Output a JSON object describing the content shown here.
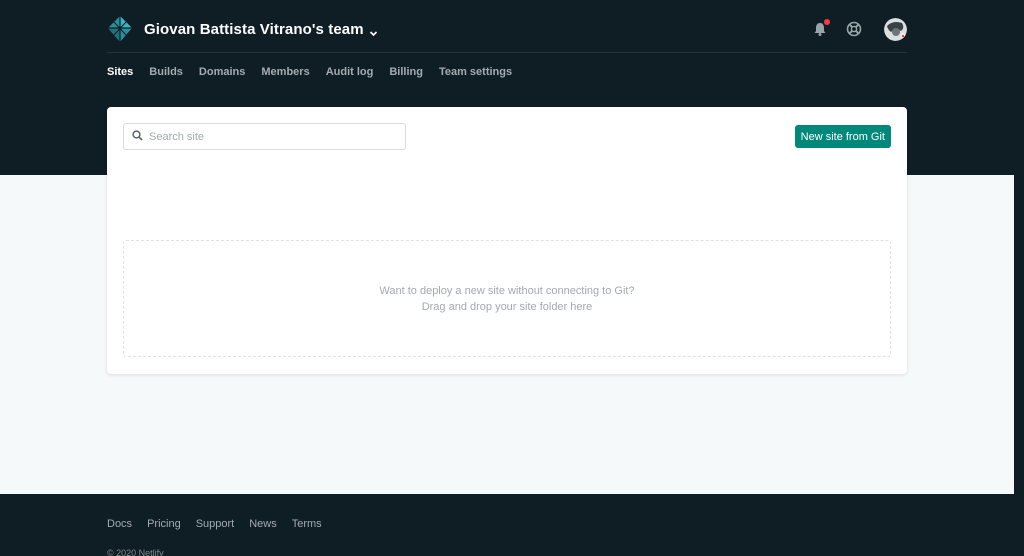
{
  "header": {
    "team_name": "Giovan Battista Vitrano's team"
  },
  "nav": {
    "items": [
      {
        "label": "Sites",
        "active": true
      },
      {
        "label": "Builds"
      },
      {
        "label": "Domains"
      },
      {
        "label": "Members"
      },
      {
        "label": "Audit log"
      },
      {
        "label": "Billing"
      },
      {
        "label": "Team settings"
      }
    ]
  },
  "search": {
    "placeholder": "Search site",
    "value": ""
  },
  "actions": {
    "new_site_label": "New site from Git"
  },
  "dropzone": {
    "line1": "Want to deploy a new site without connecting to Git?",
    "line2": "Drag and drop your site folder here"
  },
  "footer": {
    "links": [
      "Docs",
      "Pricing",
      "Support",
      "News",
      "Terms"
    ],
    "copyright": "© 2020 Netlify"
  },
  "icons": {
    "logo": "netlify-logo-icon",
    "caret": "chevron-down-icon",
    "bell": "bell-icon",
    "help": "lifebuoy-icon",
    "search": "search-icon"
  },
  "colors": {
    "header_bg": "#0f1e25",
    "accent": "#00897b",
    "notification": "#fa3946"
  }
}
